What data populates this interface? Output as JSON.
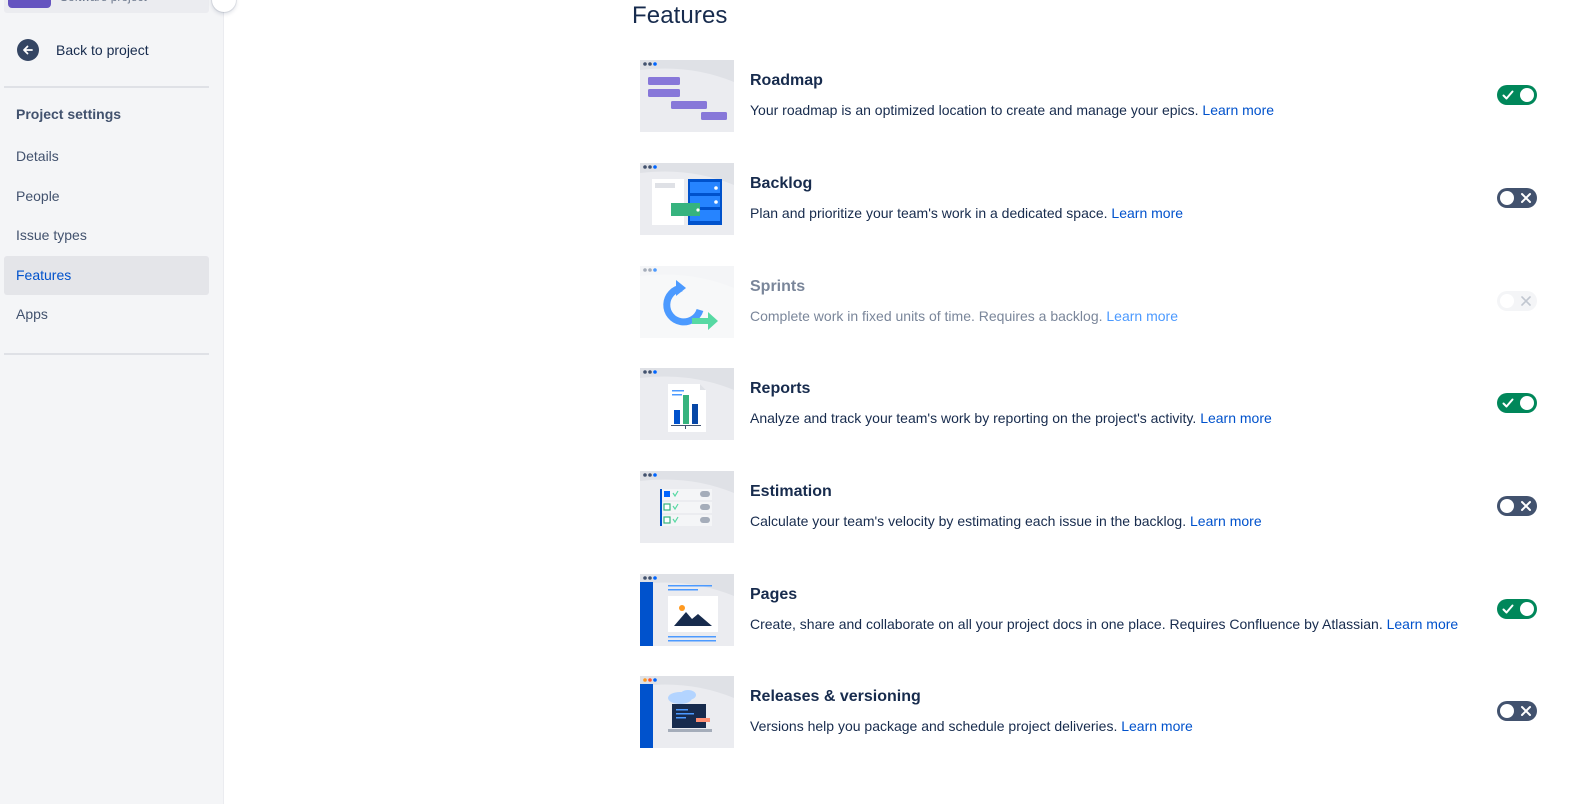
{
  "sidebar": {
    "project_type": "Software project",
    "back_label": "Back to project",
    "heading": "Project settings",
    "items": [
      {
        "label": "Details",
        "active": false
      },
      {
        "label": "People",
        "active": false
      },
      {
        "label": "Issue types",
        "active": false
      },
      {
        "label": "Features",
        "active": true
      },
      {
        "label": "Apps",
        "active": false
      }
    ]
  },
  "main": {
    "title": "Features",
    "learn_more": "Learn more",
    "features": [
      {
        "title": "Roadmap",
        "description": "Your roadmap is an optimized location to create and manage your epics.",
        "state": "on",
        "icon": "roadmap-illustration"
      },
      {
        "title": "Backlog",
        "description": "Plan and prioritize your team's work in a dedicated space.",
        "state": "off",
        "icon": "backlog-illustration"
      },
      {
        "title": "Sprints",
        "description": "Complete work in fixed units of time. Requires a backlog.",
        "state": "disabled",
        "icon": "sprints-illustration"
      },
      {
        "title": "Reports",
        "description": "Analyze and track your team's work by reporting on the project's activity.",
        "state": "on",
        "icon": "reports-illustration"
      },
      {
        "title": "Estimation",
        "description": "Calculate your team's velocity by estimating each issue in the backlog.",
        "state": "off",
        "icon": "estimation-illustration"
      },
      {
        "title": "Pages",
        "description": "Create, share and collaborate on all your project docs in one place. Requires Confluence by Atlassian.",
        "state": "on",
        "icon": "pages-illustration"
      },
      {
        "title": "Releases & versioning",
        "description": "Versions help you package and schedule project deliveries.",
        "state": "off",
        "icon": "releases-illustration"
      }
    ]
  },
  "colors": {
    "toggle_on": "#00875a",
    "toggle_off": "#42526e",
    "link": "#0052cc",
    "active_nav": "#0052cc",
    "sidebar_bg": "#f4f5f7"
  }
}
